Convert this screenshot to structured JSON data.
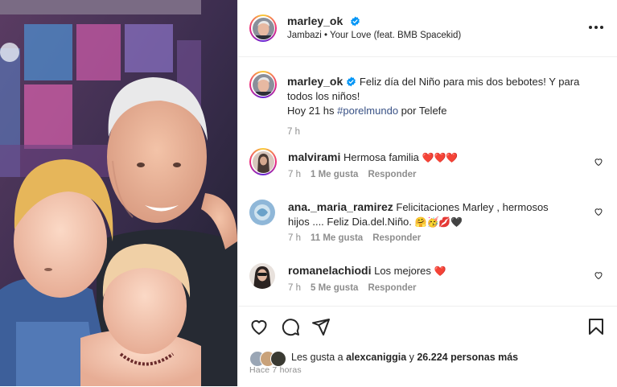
{
  "post": {
    "username": "marley_ok",
    "audio": "Jambazi • Your Love (feat. BMB Spacekid)",
    "caption_line1": "Feliz día del Niño para mis dos bebotes! Y para todos los niños!",
    "caption_line2_prefix": "Hoy 21 hs ",
    "caption_hashtag": "#porelmundo",
    "caption_line2_suffix": " por Telefe",
    "caption_time": "7 h"
  },
  "comments": [
    {
      "user": "malvirami",
      "text": "Hermosa familia",
      "emoji": "❤️❤️❤️",
      "time": "7 h",
      "likes": "1 Me gusta",
      "reply": "Responder"
    },
    {
      "user": "ana._maria_ramirez",
      "text": "Felicitaciones Marley , hermosos hijos .... Feliz Dia.del.Niño.",
      "emoji": "🤗🥳💋🖤",
      "time": "7 h",
      "likes": "11 Me gusta",
      "reply": "Responder"
    },
    {
      "user": "romanelachiodi",
      "text": "Los mejores",
      "emoji": "❤️",
      "time": "7 h",
      "likes": "5 Me gusta",
      "reply": "Responder"
    }
  ],
  "likes": {
    "prefix": "Les gusta a ",
    "user": "alexcaniggia",
    "middle": " y ",
    "count": "26.224 personas más"
  },
  "posted": "Hace 7 horas",
  "colors": {
    "heart": "#ed4956",
    "link": "#385185",
    "verified": "#0095f6"
  },
  "icons": [
    "verified-icon",
    "more-options-icon",
    "heart-icon",
    "comment-icon",
    "share-icon",
    "save-icon"
  ]
}
